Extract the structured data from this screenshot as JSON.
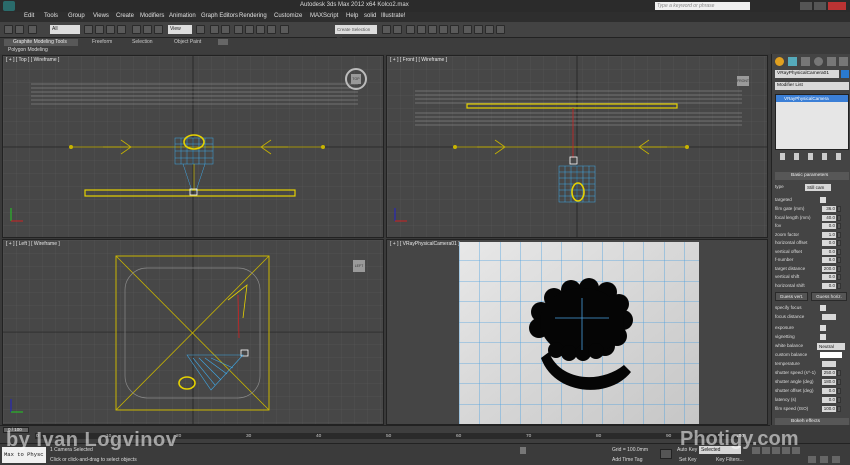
{
  "window": {
    "title": "Autodesk 3ds Max 2012 x64      Kolco2.max",
    "search_placeholder": "Type a keyword or phrase"
  },
  "menu": [
    "Edit",
    "Tools",
    "Group",
    "Views",
    "Create",
    "Modifiers",
    "Animation",
    "Graph Editors",
    "Rendering",
    "Customize",
    "MAXScript",
    "Help",
    "solid",
    "Illustrate!"
  ],
  "toolbar": {
    "selection_filter": "All",
    "view_dropdown": "View",
    "named_selection": "Create Selection Se"
  },
  "ribbon": {
    "tabs": [
      "Graphite Modeling Tools",
      "Freeform",
      "Selection",
      "Object Paint"
    ],
    "sub_label": "Polygon Modeling"
  },
  "viewports": {
    "top": {
      "label": "[ + ] [ Top ] [ Wireframe ]",
      "cube": "TOP"
    },
    "front": {
      "label": "[ + ] [ Front ] [ Wireframe ]",
      "cube": "FRONT"
    },
    "left": {
      "label": "[ + ] [ Left ] [ Wireframe ]",
      "cube": "LEFT"
    },
    "camera": {
      "label": "[ + ] [ VRayPhysicalCamera01 ]"
    }
  },
  "command_panel": {
    "object_name": "VRayPhysicalCamera01",
    "modifier_list": "Modifier List",
    "stack_item": "VRayPhysicalCamera",
    "rollout_title": "Basic parameters",
    "type_label": "type",
    "type_value": "Still cam",
    "targeted": "targeted",
    "params": [
      {
        "label": "film gate (mm)",
        "value": "36.0"
      },
      {
        "label": "focal length (mm)",
        "value": "40.0"
      },
      {
        "label": "fov",
        "value": "0.0"
      },
      {
        "label": "zoom factor",
        "value": "1.0"
      },
      {
        "label": "horizontal offset",
        "value": "0.0"
      },
      {
        "label": "vertical offset",
        "value": "0.0"
      },
      {
        "label": "f-number",
        "value": "8.0"
      },
      {
        "label": "target distance",
        "value": "200.0"
      },
      {
        "label": "vertical shift",
        "value": "0.0"
      },
      {
        "label": "horizontal shift",
        "value": "0.0"
      }
    ],
    "guess_vert": "Guess vert.",
    "guess_horiz": "Guess horiz.",
    "specify_focus": "specify focus",
    "focus_distance": "focus distance",
    "exposure": "exposure",
    "vignetting": "vignetting",
    "white_balance_label": "white balance",
    "white_balance_value": "Neutral",
    "custom_balance": "custom balance",
    "temperature": "temperature",
    "shutter_params": [
      {
        "label": "shutter speed (s^-1)",
        "value": "250.0"
      },
      {
        "label": "shutter angle (deg)",
        "value": "180.0"
      },
      {
        "label": "shutter offset (deg)",
        "value": "0.0"
      },
      {
        "label": "latency (s)",
        "value": "0.0"
      },
      {
        "label": "film speed (ISO)",
        "value": "100.0"
      }
    ],
    "bokeh_title": "Bokeh effects"
  },
  "timeline": {
    "frame_counter": "0 / 100",
    "ticks": [
      "0",
      "10",
      "20",
      "30",
      "40",
      "50",
      "60",
      "70",
      "80",
      "90",
      "100"
    ]
  },
  "status": {
    "maxscript_label": "Max to Physc",
    "selected_text": "1 Camera Selected",
    "prompt_text": "Click or click-and-drag to select objects",
    "grid": "Grid = 100.0mm",
    "add_time_tag": "Add Time Tag",
    "auto_key": "Auto Key",
    "set_key": "Set Key",
    "selected_dropdown": "Selected",
    "key_filters": "Key Filters..."
  },
  "watermarks": {
    "author": "by Ivan Logvinov",
    "site": "Photigy.com"
  }
}
